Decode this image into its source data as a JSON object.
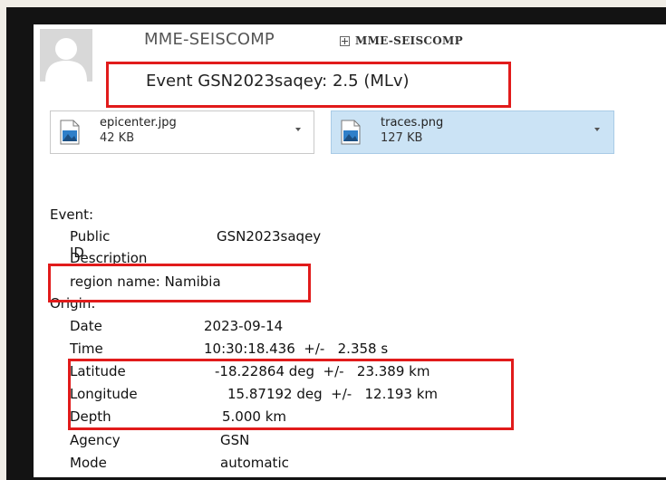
{
  "header": {
    "sender": "MME-SEISCOMP",
    "recipient": "MME-SEISCOMP",
    "subject": "Event GSN2023saqey: 2.5 (MLv)"
  },
  "attachments": [
    {
      "name": "epicenter.jpg",
      "size": "42 KB",
      "icon": "image-file-icon"
    },
    {
      "name": "traces.png",
      "size": "127 KB",
      "icon": "image-file-icon"
    }
  ],
  "body": {
    "event_heading": "Event:",
    "public_id_label": "Public ID",
    "public_id_value": "GSN2023saqey",
    "description_label": "Description",
    "region_line": "region name: Namibia",
    "origin_heading": "Origin:",
    "date_label": "Date",
    "date_value": "2023-09-14",
    "time_label": "Time",
    "time_value": "10:30:18.436  +/-   2.358 s",
    "latitude_label": "Latitude",
    "latitude_value": "-18.22864 deg  +/-   23.389 km",
    "longitude_label": "Longitude",
    "longitude_value": "15.87192 deg  +/-   12.193 km",
    "depth_label": "Depth",
    "depth_value": "5.000 km",
    "agency_label": "Agency",
    "agency_value": "GSN",
    "mode_label": "Mode",
    "mode_value": "automatic"
  },
  "colors": {
    "highlight": "#e11b1b",
    "selected_attachment": "#cbe3f5",
    "frame": "#131313"
  }
}
